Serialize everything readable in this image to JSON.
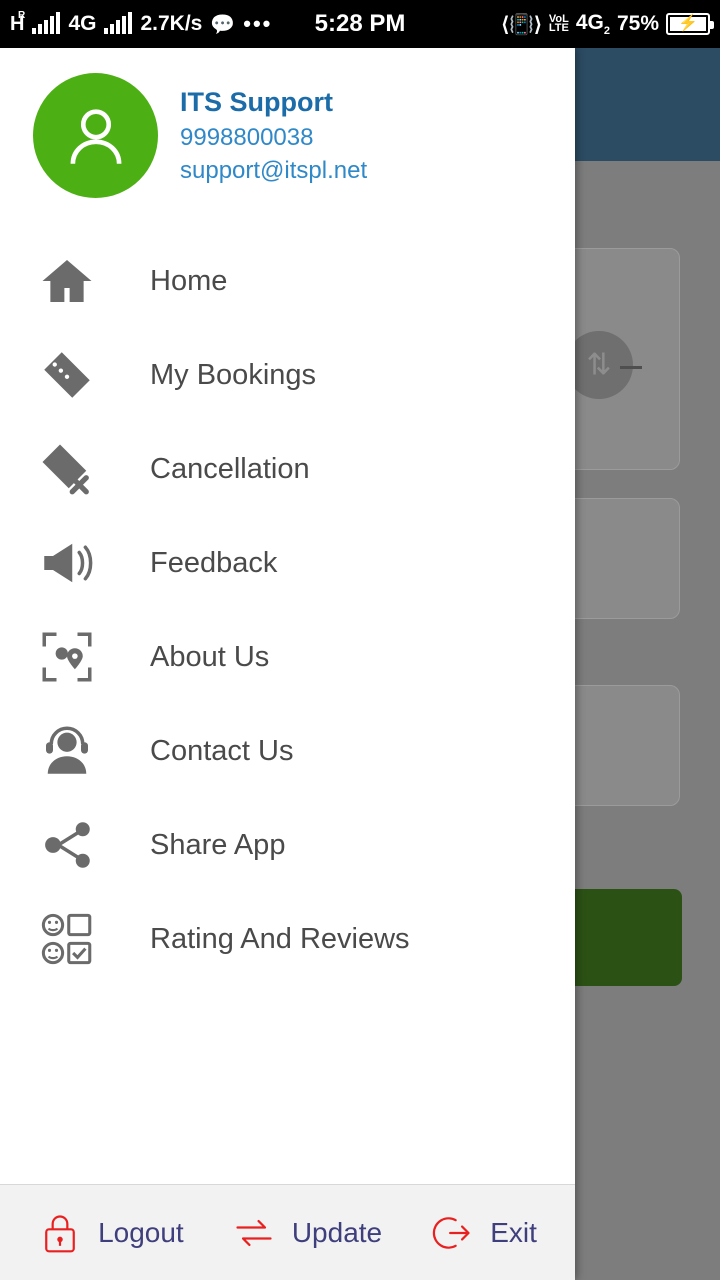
{
  "status_bar": {
    "network_letter": "H",
    "network_sup": "R",
    "network_type": "4G",
    "data_rate": "2.7K/s",
    "message_icon": "chat-bubble-icon",
    "more_icon": "ellipsis-icon",
    "time": "5:28 PM",
    "vibrate_icon": "vibrate-icon",
    "volte_top": "VoL",
    "volte_bottom": "LTE",
    "sim2_label": "4G",
    "sim2_sub": "2",
    "battery_percent": "75%",
    "battery_charging_icon": "charging-bolt-icon"
  },
  "drawer": {
    "profile": {
      "avatar_icon": "user-avatar-icon",
      "name": "ITS Support",
      "phone": "9998800038",
      "email": "support@itspl.net"
    },
    "menu_items": [
      {
        "label": "Home",
        "icon": "home-icon"
      },
      {
        "label": "My Bookings",
        "icon": "ticket-icon"
      },
      {
        "label": "Cancellation",
        "icon": "ticket-cancel-icon"
      },
      {
        "label": "Feedback",
        "icon": "megaphone-icon"
      },
      {
        "label": "About Us",
        "icon": "location-scan-icon"
      },
      {
        "label": "Contact Us",
        "icon": "headset-support-icon"
      },
      {
        "label": "Share App",
        "icon": "share-nodes-icon"
      },
      {
        "label": "Rating And Reviews",
        "icon": "rating-reviews-icon"
      }
    ],
    "bottom_bar": [
      {
        "label": "Logout",
        "icon": "lock-icon"
      },
      {
        "label": "Update",
        "icon": "refresh-arrows-icon"
      },
      {
        "label": "Exit",
        "icon": "exit-arrow-icon"
      }
    ]
  },
  "background_app": {
    "header_color": "#123c5c",
    "button_color": "#234d0a",
    "accent_blue": "#1b6ca8",
    "avatar_green": "#4caf13",
    "action_red": "#e8201f"
  }
}
